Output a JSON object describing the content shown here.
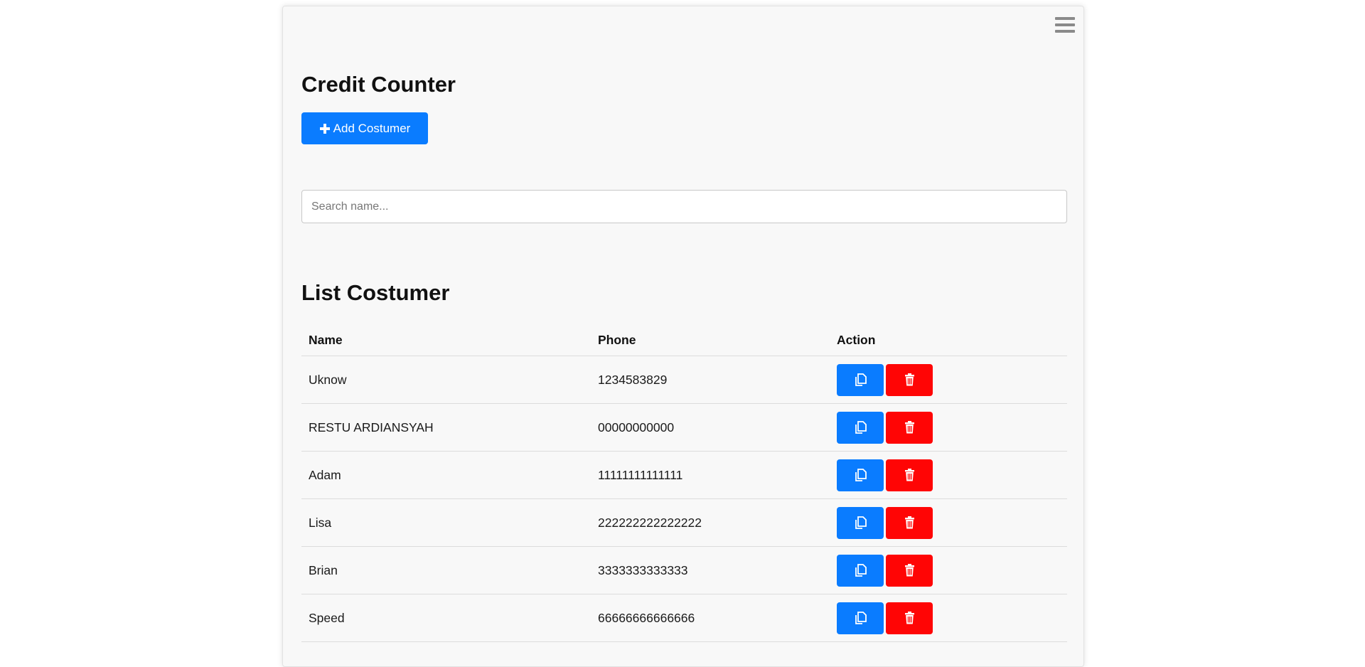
{
  "app": {
    "title": "Credit Counter",
    "add_button_label": "Add Costumer",
    "add_button_icon": "plus-icon",
    "menu_icon": "hamburger-menu-icon"
  },
  "search": {
    "placeholder": "Search name...",
    "value": ""
  },
  "list": {
    "title": "List Costumer",
    "columns": [
      "Name",
      "Phone",
      "Action"
    ],
    "rows": [
      {
        "name": "Uknow",
        "phone": "1234583829"
      },
      {
        "name": "RESTU ARDIANSYAH",
        "phone": "00000000000"
      },
      {
        "name": "Adam",
        "phone": "11111111111111"
      },
      {
        "name": "Lisa",
        "phone": "222222222222222"
      },
      {
        "name": "Brian",
        "phone": "3333333333333"
      },
      {
        "name": "Speed",
        "phone": "66666666666666"
      }
    ],
    "row_actions": [
      "copy-icon",
      "trash-icon"
    ]
  },
  "colors": {
    "primary": "#0a7cff",
    "danger": "#ff0505",
    "panel_background": "#f8f8f8"
  }
}
